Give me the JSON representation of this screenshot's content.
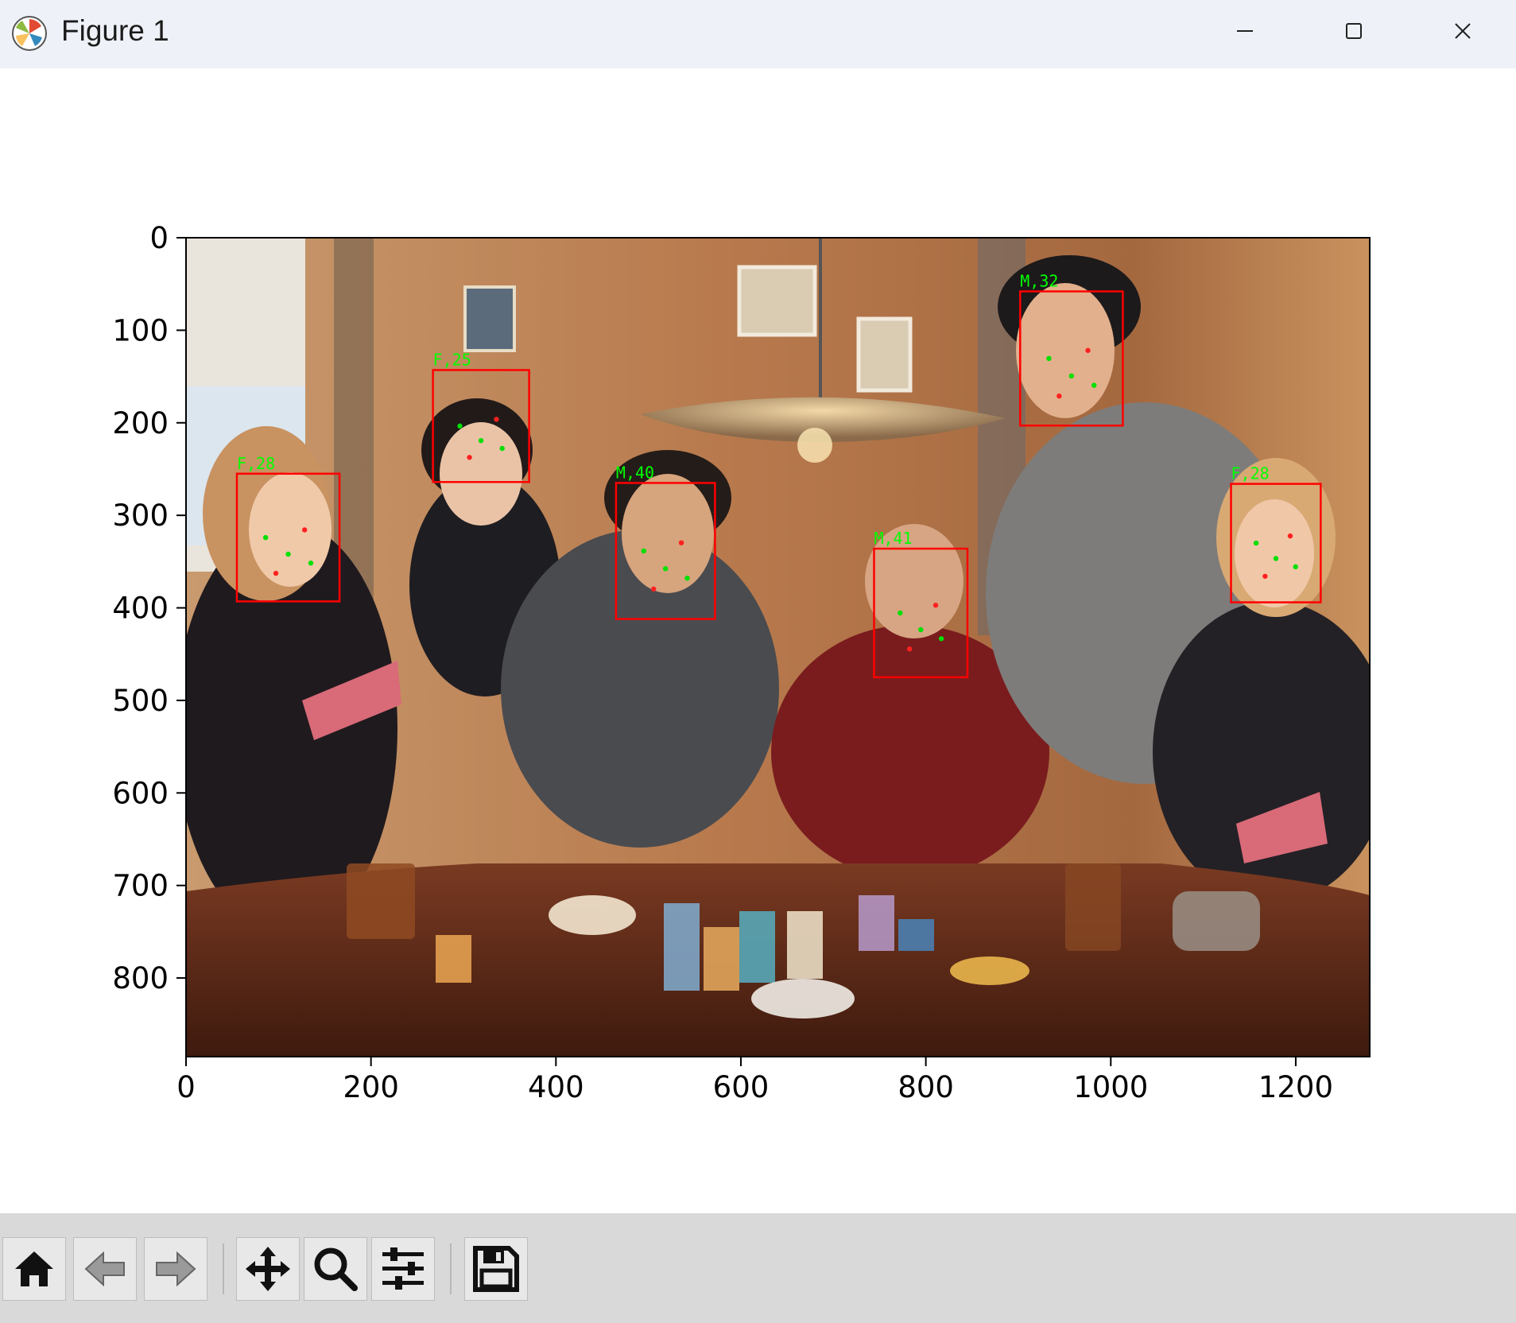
{
  "window": {
    "title": "Figure 1",
    "app_icon": "matplotlib-icon",
    "controls": [
      "minimize-icon",
      "maximize-icon",
      "close-icon"
    ]
  },
  "axes": {
    "y_ticks": [
      "0",
      "100",
      "200",
      "300",
      "400",
      "500",
      "600",
      "700",
      "800"
    ],
    "x_ticks": [
      "0",
      "200",
      "400",
      "600",
      "800",
      "1000",
      "1200"
    ],
    "x_range": [
      0,
      1280
    ],
    "y_range": [
      0,
      885
    ]
  },
  "image": {
    "description_icon": "photo-image",
    "face_boxes": [
      {
        "label": "F,28",
        "x0": 55,
        "y0": 255,
        "x1": 166,
        "y1": 393
      },
      {
        "label": "F,25",
        "x0": 267,
        "y0": 143,
        "x1": 371,
        "y1": 264
      },
      {
        "label": "M,40",
        "x0": 465,
        "y0": 265,
        "x1": 572,
        "y1": 412
      },
      {
        "label": "M,41",
        "x0": 744,
        "y0": 336,
        "x1": 845,
        "y1": 475
      },
      {
        "label": "M,32",
        "x0": 902,
        "y0": 58,
        "x1": 1013,
        "y1": 203
      },
      {
        "label": "F,28",
        "x0": 1130,
        "y0": 266,
        "x1": 1227,
        "y1": 394
      }
    ],
    "box_color": "#ff0000",
    "label_color": "#00ff00"
  },
  "toolbar": {
    "buttons": [
      {
        "name": "home-icon"
      },
      {
        "name": "back-arrow-icon"
      },
      {
        "name": "forward-arrow-icon"
      },
      {
        "name": "pan-icon"
      },
      {
        "name": "zoom-icon"
      },
      {
        "name": "configure-subplots-icon"
      },
      {
        "name": "save-icon"
      }
    ]
  }
}
